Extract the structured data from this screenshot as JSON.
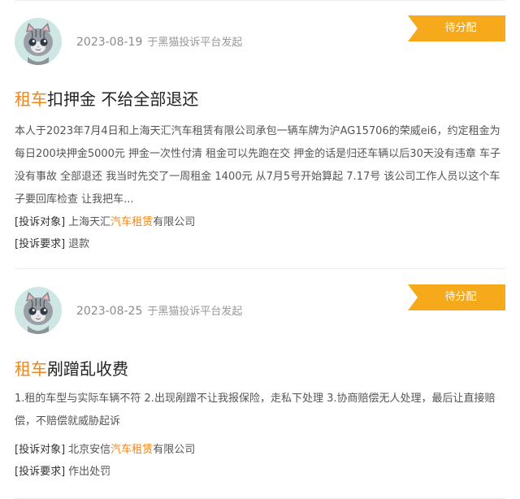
{
  "complaints": [
    {
      "date": "2023-08-19",
      "source": "于黑猫投诉平台发起",
      "status": "待分配",
      "title_highlight": "租车",
      "title_rest": "扣押金 不给全部退还",
      "summary": "本人于2023年7月4日和上海天汇汽车租赁有限公司承包一辆车牌为沪AG15706的荣威ei6，约定租金为每日200块押金5000元 押金一次性付清 租金可以先跑在交 押金的话是归还车辆以后30天没有违章 车子没有事故 全部退还 我当时先交了一周租金 1400元 从7月5号开始算起 7.17号 该公司工作人员以这个车子要回库检查 让我把车...",
      "target_label": "[投诉对象]",
      "target_pre": "上海天汇",
      "target_highlight": "汽车租赁",
      "target_post": "有限公司",
      "demand_label": "[投诉要求]",
      "demand": "退款"
    },
    {
      "date": "2023-08-25",
      "source": "于黑猫投诉平台发起",
      "status": "待分配",
      "title_highlight": "租车",
      "title_rest": "剐蹭乱收费",
      "summary": "1.租的车型与实际车辆不符 2.出现剐蹭不让我报保险，走私下处理 3.协商赔偿无人处理，最后让直接赔偿，不赔偿就威胁起诉",
      "target_label": "[投诉对象]",
      "target_pre": "北京安信",
      "target_highlight": "汽车租赁",
      "target_post": "有限公司",
      "demand_label": "[投诉要求]",
      "demand": "作出处罚"
    }
  ],
  "colors": {
    "accent_orange": "#f08519",
    "status_badge": "#f7a91c",
    "avatar_bg": "#cfe7e4"
  },
  "icons": {
    "avatar": "grey-cat-avatar-icon",
    "status": "ribbon-tag"
  }
}
